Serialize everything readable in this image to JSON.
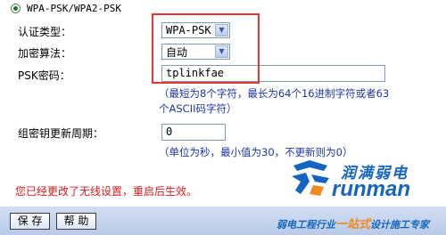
{
  "security_mode": {
    "label": "WPA-PSK/WPA2-PSK"
  },
  "auth_type": {
    "label": "认证类型：",
    "value": "WPA-PSK"
  },
  "encryption": {
    "label": "加密算法：",
    "value": "自动"
  },
  "psk_password": {
    "label": "PSK密码：",
    "value": "tplinkfae",
    "hint_line1": "（最短为8个字符，最长为64个16进制字符或者63",
    "hint_line2": "个ASCII码字符）"
  },
  "group_key_period": {
    "label": "组密钥更新周期：",
    "value": "0",
    "hint": "（单位为秒，最小值为30，不更新则为0）"
  },
  "warning": "您已经更改了无线设置，重启后生效。",
  "buttons": {
    "save": "保 存",
    "help": "帮 助"
  },
  "branding": {
    "chinese": "润满弱电",
    "english": "runman",
    "tagline_pre": "弱电工程行业",
    "tagline_mid": "一站式",
    "tagline_post": "设计施工专家",
    "colors": {
      "blue": "#1565c0",
      "orange": "#f08a1c"
    }
  }
}
